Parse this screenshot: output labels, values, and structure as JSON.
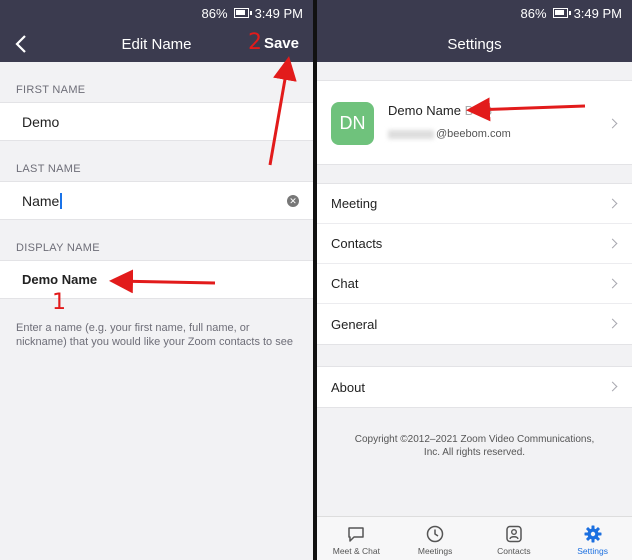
{
  "left": {
    "status": {
      "battery": "86%",
      "time": "3:49 PM"
    },
    "nav": {
      "title": "Edit Name",
      "save_label": "Save"
    },
    "first_name": {
      "label": "FIRST NAME",
      "value": "Demo"
    },
    "last_name": {
      "label": "LAST NAME",
      "value": "Name"
    },
    "display_name": {
      "label": "DISPLAY NAME",
      "value": "Demo Name"
    },
    "hint": "Enter a name (e.g. your first name, full name, or nickname) that you would like your Zoom contacts to see"
  },
  "right": {
    "status": {
      "battery": "86%",
      "time": "3:49 PM"
    },
    "nav": {
      "title": "Settings"
    },
    "profile": {
      "initials": "DN",
      "name": "Demo Name",
      "name_faded": "BGS",
      "email": "@beebom.com",
      "avatar_color": "#6fc27c"
    },
    "menu": [
      "Meeting",
      "Contacts",
      "Chat",
      "General"
    ],
    "about": "About",
    "copyright": [
      "Copyright ©2012–2021 Zoom Video Communications,",
      "Inc. All rights reserved."
    ],
    "tabs": [
      {
        "label": "Meet & Chat",
        "icon": "chat-bubble-icon",
        "active": false
      },
      {
        "label": "Meetings",
        "icon": "clock-icon",
        "active": false
      },
      {
        "label": "Contacts",
        "icon": "contact-card-icon",
        "active": false
      },
      {
        "label": "Settings",
        "icon": "gear-icon",
        "active": true
      }
    ]
  },
  "annotations": {
    "step1": "1",
    "step2": "2",
    "arrow_color": "#e21b1b"
  }
}
